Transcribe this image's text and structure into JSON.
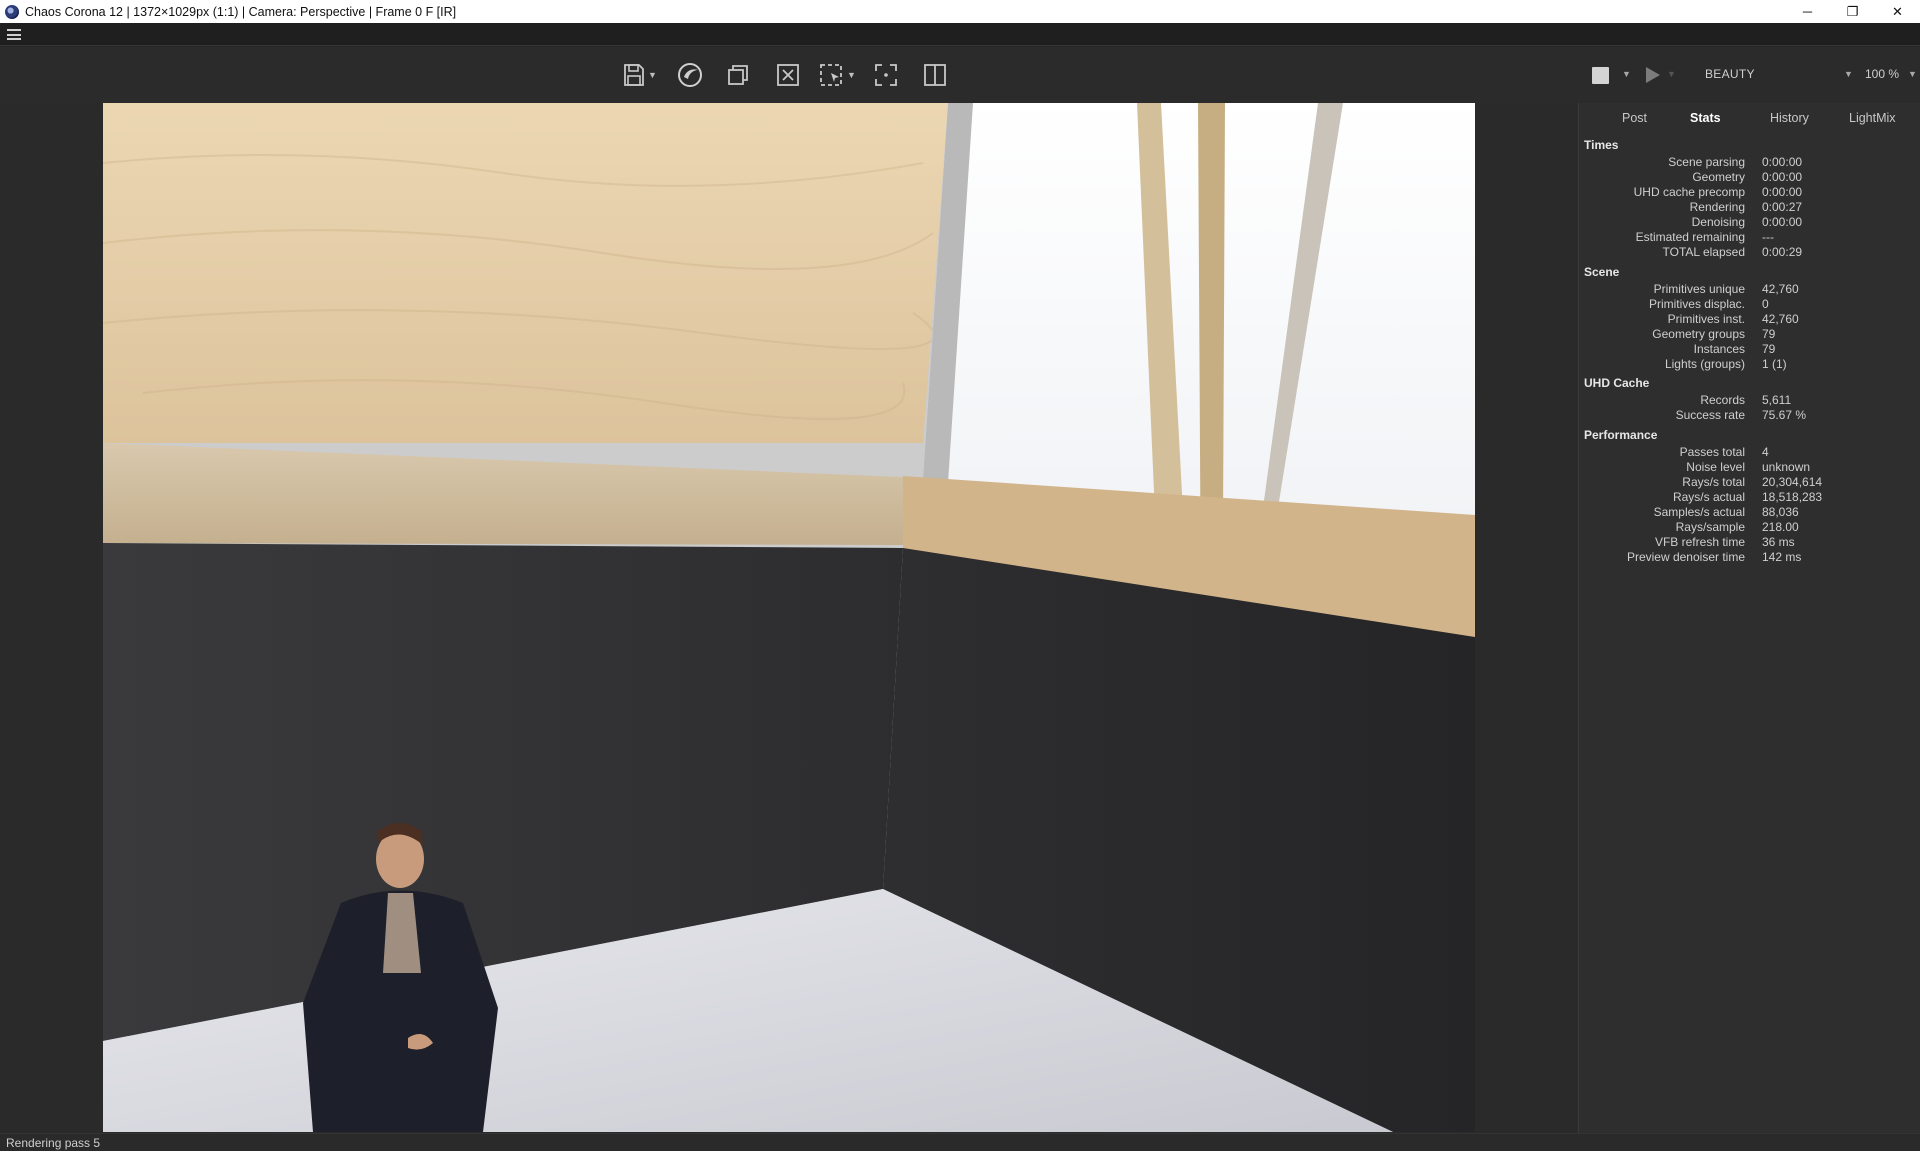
{
  "window": {
    "title": "Chaos Corona 12 | 1372×1029px (1:1) | Camera: Perspective | Frame 0 F [IR]",
    "controls": {
      "minimize": "─",
      "maximize": "❐",
      "close": "✕"
    }
  },
  "toolbar": {
    "icons": [
      "save-icon",
      "corona-logo-icon",
      "copy-icon",
      "clear-icon",
      "region-select-icon",
      "focus-icon",
      "split-view-icon"
    ]
  },
  "render_controls": {
    "channel": "BEAUTY",
    "zoom": "100 %"
  },
  "panel": {
    "tabs": [
      {
        "label": "Post",
        "active": false
      },
      {
        "label": "Stats",
        "active": true
      },
      {
        "label": "History",
        "active": false
      },
      {
        "label": "LightMix",
        "active": false
      }
    ],
    "sections": [
      {
        "title": "Times",
        "rows": [
          {
            "key": "Scene parsing",
            "value": "0:00:00"
          },
          {
            "key": "Geometry",
            "value": "0:00:00"
          },
          {
            "key": "UHD cache precomp",
            "value": "0:00:00"
          },
          {
            "key": "Rendering",
            "value": "0:00:27"
          },
          {
            "key": "Denoising",
            "value": "0:00:00"
          },
          {
            "key": "Estimated remaining",
            "value": "---"
          },
          {
            "key": "TOTAL elapsed",
            "value": "0:00:29"
          }
        ]
      },
      {
        "title": "Scene",
        "rows": [
          {
            "key": "Primitives unique",
            "value": "42,760"
          },
          {
            "key": "Primitives displac.",
            "value": "0"
          },
          {
            "key": "Primitives inst.",
            "value": "42,760"
          },
          {
            "key": "Geometry groups",
            "value": "79"
          },
          {
            "key": "Instances",
            "value": "79"
          },
          {
            "key": "Lights (groups)",
            "value": "1 (1)"
          }
        ]
      },
      {
        "title": "UHD Cache",
        "rows": [
          {
            "key": "Records",
            "value": "5,611"
          },
          {
            "key": "Success rate",
            "value": "75.67 %"
          }
        ]
      },
      {
        "title": "Performance",
        "rows": [
          {
            "key": "Passes total",
            "value": "4"
          },
          {
            "key": "Noise level",
            "value": "unknown"
          },
          {
            "key": "Rays/s total",
            "value": "20,304,614"
          },
          {
            "key": "Rays/s actual",
            "value": "18,518,283"
          },
          {
            "key": "Samples/s actual",
            "value": "88,036"
          },
          {
            "key": "Rays/sample",
            "value": "218.00"
          },
          {
            "key": "VFB refresh time",
            "value": "36 ms"
          },
          {
            "key": "Preview denoiser time",
            "value": "142 ms"
          }
        ]
      }
    ]
  },
  "status": {
    "text": "Rendering pass 5"
  }
}
